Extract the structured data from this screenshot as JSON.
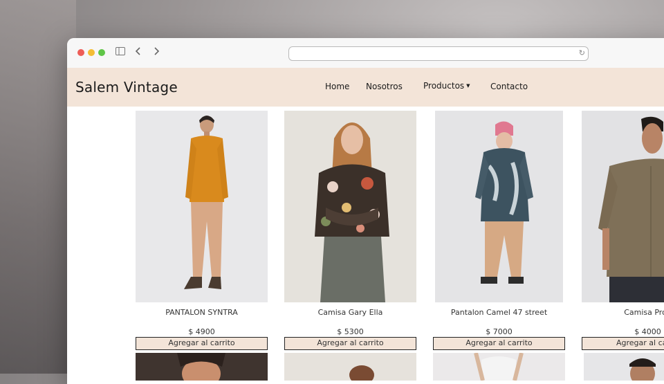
{
  "browser": {
    "address_text": "",
    "icons": [
      "sidebar-icon",
      "chevron-left-icon",
      "chevron-right-icon",
      "reload-icon"
    ]
  },
  "site": {
    "logo": "Salem Vintage",
    "nav": {
      "home": "Home",
      "nosotros": "Nosotros",
      "productos": "Productos",
      "contacto": "Contacto"
    },
    "header_bg": "#f3e4d8"
  },
  "products": [
    {
      "name": "PANTALON SYNTRA",
      "price": "$ 4900",
      "button": "Agregar al carrito"
    },
    {
      "name": "Camisa Gary Ella",
      "price": "$ 5300",
      "button": "Agregar al carrito"
    },
    {
      "name": "Pantalon Camel 47 street",
      "price": "$ 7000",
      "button": "Agregar al carrito"
    },
    {
      "name": "Camisa Prod",
      "price": "$ 4000",
      "button": "Agregar al ca"
    }
  ]
}
